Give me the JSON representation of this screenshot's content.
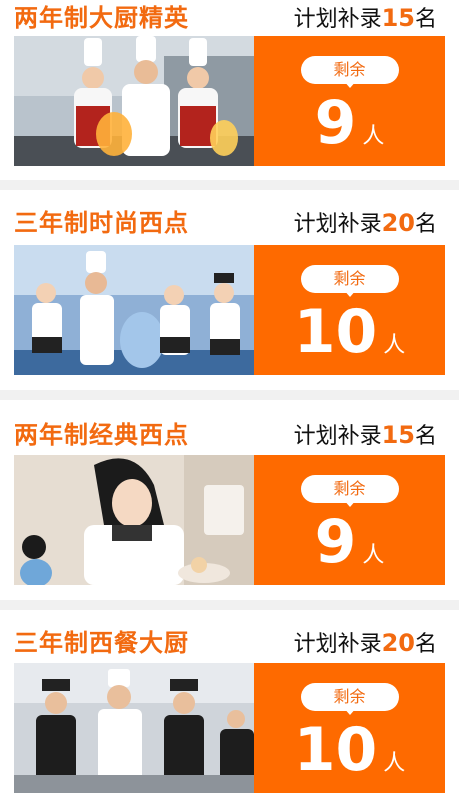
{
  "courses": [
    {
      "title": "两年制大厨精英",
      "plan_prefix": "计划补录",
      "plan_count": "15",
      "plan_suffix": "名",
      "remaining_label": "剩余",
      "remaining_count": "9",
      "remaining_unit": "人"
    },
    {
      "title": "三年制时尚西点",
      "plan_prefix": "计划补录",
      "plan_count": "20",
      "plan_suffix": "名",
      "remaining_label": "剩余",
      "remaining_count": "10",
      "remaining_unit": "人"
    },
    {
      "title": "两年制经典西点",
      "plan_prefix": "计划补录",
      "plan_count": "15",
      "plan_suffix": "名",
      "remaining_label": "剩余",
      "remaining_count": "9",
      "remaining_unit": "人"
    },
    {
      "title": "三年制西餐大厨",
      "plan_prefix": "计划补录",
      "plan_count": "20",
      "plan_suffix": "名",
      "remaining_label": "剩余",
      "remaining_count": "10",
      "remaining_unit": "人"
    }
  ],
  "colors": {
    "accent": "#f26a10",
    "panel": "#fe6a00",
    "separator": "#f1f1f1"
  }
}
